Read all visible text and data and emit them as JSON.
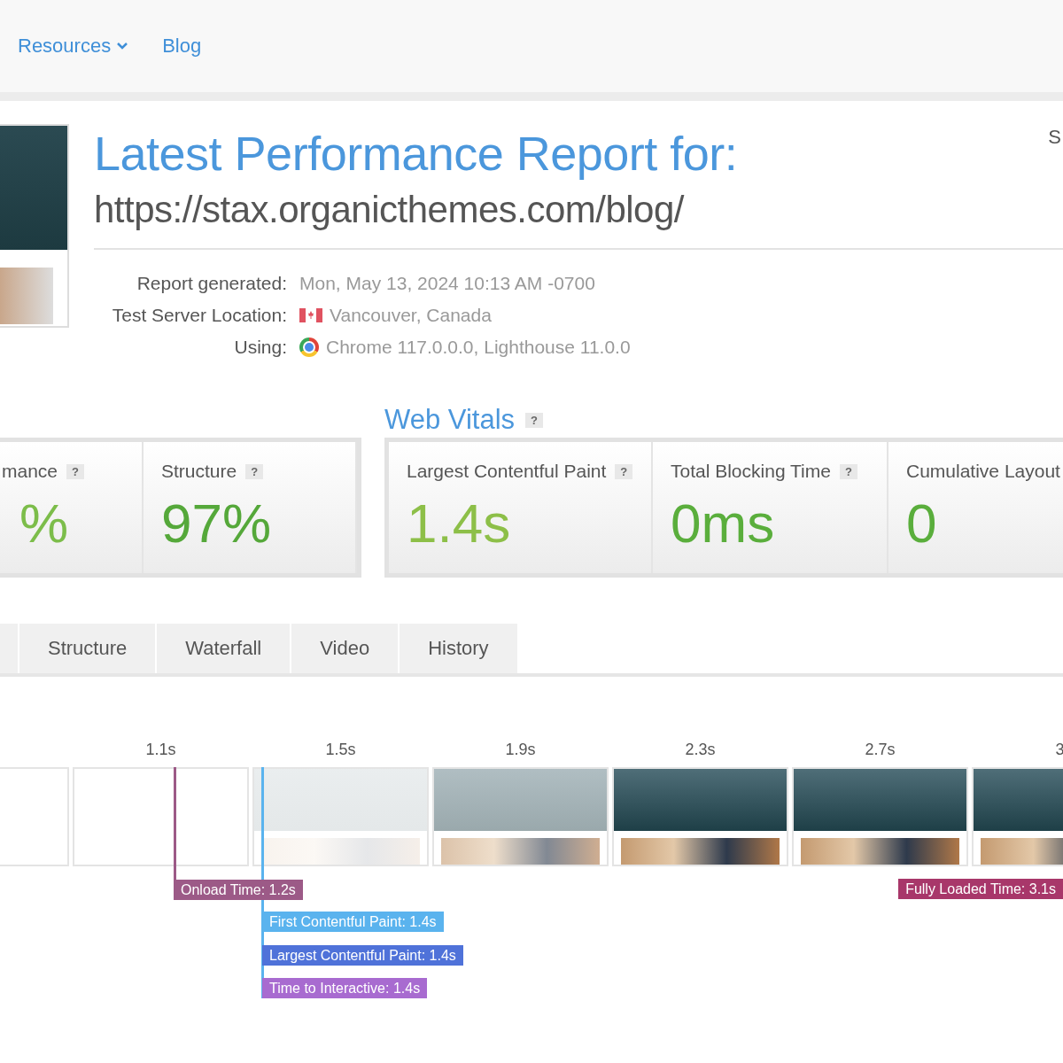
{
  "nav": {
    "links": [
      {
        "label": "Resources",
        "dropdown": true
      },
      {
        "label": "Blog",
        "dropdown": false
      }
    ]
  },
  "header": {
    "title": "Latest Performance Report for:",
    "url": "https://stax.organicthemes.com/blog/",
    "edge_text": "S"
  },
  "details": [
    {
      "label": "Report generated:",
      "value": "Mon, May 13, 2024 10:13 AM -0700",
      "kind": "date"
    },
    {
      "label": "Test Server Location:",
      "value": "Vancouver, Canada",
      "kind": "location"
    },
    {
      "label": "Using:",
      "value": "Chrome 117.0.0.0, Lighthouse 11.0.0",
      "kind": "software"
    }
  ],
  "scores": [
    {
      "label": "mance",
      "help": "?",
      "value": "%",
      "color": "#7cbd4a"
    },
    {
      "label": "Structure",
      "help": "?",
      "value": "97%",
      "color": "#55a83a"
    }
  ],
  "web_vitals": {
    "title": "Web Vitals",
    "help": "?",
    "cards": [
      {
        "label": "Largest Contentful Paint",
        "help": "?",
        "value": "1.4s",
        "color": "#8dbf48"
      },
      {
        "label": "Total Blocking Time",
        "help": "?",
        "value": "0ms",
        "color": "#5aae3c"
      },
      {
        "label": "Cumulative Layout",
        "value": "0",
        "color": "#5aae3c"
      }
    ]
  },
  "tabs": [
    {
      "label": "Structure",
      "selected": false
    },
    {
      "label": "Waterfall",
      "selected": false
    },
    {
      "label": "Video",
      "selected": false
    },
    {
      "label": "History",
      "selected": false
    }
  ],
  "timeline": {
    "frames": [
      {
        "kind": "blank"
      },
      {
        "time": "1.1s",
        "kind": "blank"
      },
      {
        "time": "1.5s",
        "kind": "faint"
      },
      {
        "time": "1.9s",
        "kind": "partial"
      },
      {
        "time": "2.3s",
        "kind": "full"
      },
      {
        "time": "2.7s",
        "kind": "full"
      },
      {
        "time": "3",
        "kind": "full"
      }
    ],
    "markers": [
      {
        "kind": "onload",
        "label": "Onload Time: 1.2s",
        "color": "#9c5a87"
      },
      {
        "kind": "fully_loaded",
        "label": "Fully Loaded Time: 3.1s",
        "color": "#a8376a"
      },
      {
        "kind": "fcp",
        "label": "First Contentful Paint: 1.4s",
        "color": "#5ab3ee"
      },
      {
        "kind": "lcp",
        "label": "Largest Contentful Paint: 1.4s",
        "color": "#4f72d9"
      },
      {
        "kind": "tti",
        "label": "Time to Interactive: 1.4s",
        "color": "#a86bd0"
      }
    ]
  }
}
